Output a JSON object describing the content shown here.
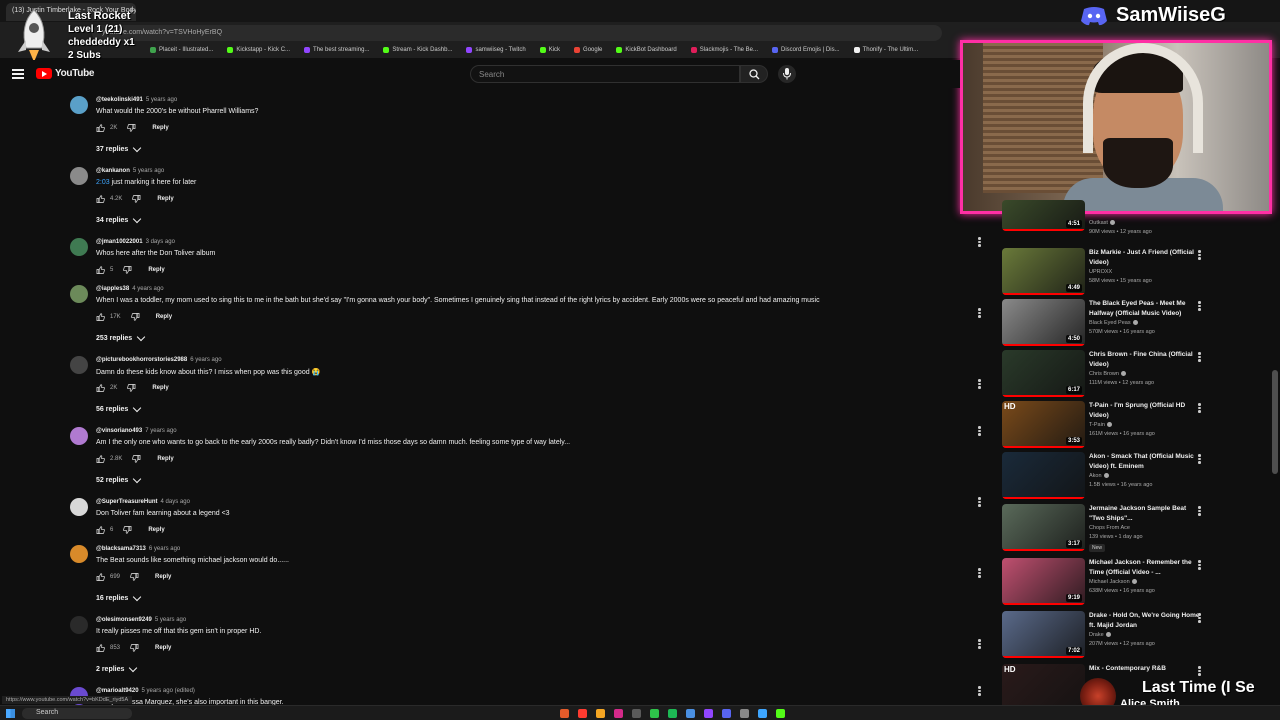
{
  "browser": {
    "tab_title": "(13) Justin Timberlake - Rock Your Body",
    "new_tab_glyph": "+",
    "url": "youtube.com/watch?v=TSVHoHyErBQ",
    "bookmarks": [
      {
        "label": "Placeit - Illustrated...",
        "color": "#3fa34d"
      },
      {
        "label": "Kickstapp - Kick C...",
        "color": "#53fc18"
      },
      {
        "label": "The best streaming...",
        "color": "#9146ff"
      },
      {
        "label": "Stream - Kick Dashb...",
        "color": "#53fc18"
      },
      {
        "label": "samwiiseg - Twitch",
        "color": "#9146ff"
      },
      {
        "label": "Kick",
        "color": "#53fc18"
      },
      {
        "label": "Google",
        "color": "#ea4335"
      },
      {
        "label": "KickBot Dashboard",
        "color": "#53fc18"
      },
      {
        "label": "Slackmojis - The Be...",
        "color": "#e01e5a"
      },
      {
        "label": "Discord Emojis | Dis...",
        "color": "#5865f2"
      },
      {
        "label": "Thonify - The Ultim...",
        "color": "#f1f1f1"
      }
    ]
  },
  "overlay": {
    "line1": "Last Rocket",
    "line2": "Level 1 (21)",
    "line3": "cheddeddy x1",
    "line4": "2 Subs",
    "discord_name": "SamWiiseG"
  },
  "youtube": {
    "logo_text": "YouTube",
    "search_placeholder": "Search"
  },
  "comments": [
    {
      "user": "@teekolinski491",
      "time": "5 years ago",
      "text": "What would the 2000's be without Pharrell Williams?",
      "likes": "2K",
      "reply": "Reply",
      "replies": "37 replies",
      "avatar": "#5aa0c8"
    },
    {
      "user": "@kankanon",
      "time": "5 years ago",
      "timestamp": "2:03",
      "text": " just marking it here for later",
      "likes": "4.2K",
      "reply": "Reply",
      "replies": "34 replies",
      "avatar": "#8a8a8a"
    },
    {
      "user": "@jman10022001",
      "time": "3 days ago",
      "text": "Whos here after the Don Toliver album",
      "likes": "5",
      "reply": "Reply",
      "replies": "",
      "avatar": "#3f7a52"
    },
    {
      "user": "@iapples38",
      "time": "4 years ago",
      "text": "When I was a toddler, my mom used to sing this to me in the bath but she'd say \"I'm gonna wash your body\". Sometimes I genuinely sing that instead of the right lyrics by accident. Early 2000s were so peaceful and had amazing music",
      "likes": "17K",
      "reply": "Reply",
      "replies": "253 replies",
      "avatar": "#6c8a5a"
    },
    {
      "user": "@picturebookhorrorstories2988",
      "time": "6 years ago",
      "text": "Damn do these kids know about this? I miss when pop was this good 😭",
      "likes": "2K",
      "reply": "Reply",
      "replies": "56 replies",
      "avatar": "#444444"
    },
    {
      "user": "@vinsoriano493",
      "time": "7 years ago",
      "text": "Am I the only one who wants to go back to the early 2000s really badly? Didn't know I'd miss those days so damn much. feeling some type of way lately...",
      "likes": "2.8K",
      "reply": "Reply",
      "replies": "52 replies",
      "avatar": "#b07ad0"
    },
    {
      "user": "@SuperTreasureHunt",
      "time": "4 days ago",
      "text": "Don Toliver fam learning about a legend <3",
      "likes": "6",
      "reply": "Reply",
      "replies": "",
      "avatar": "#d8d8d8"
    },
    {
      "user": "@blacksama7313",
      "time": "6 years ago",
      "text": "The Beat sounds like something michael jackson would do......",
      "likes": "699",
      "reply": "Reply",
      "replies": "16 replies",
      "avatar": "#d88a2a"
    },
    {
      "user": "@olesimonsen9249",
      "time": "5 years ago",
      "text": "It really pisses me off that this gem isn't in proper HD.",
      "likes": "853",
      "reply": "Reply",
      "replies": "2 replies",
      "avatar": "#2a2a2a"
    },
    {
      "user": "@marioalt9420",
      "time": "5 years ago (edited)",
      "text": "als by Vanessa Marquez, she's also important in this banger.",
      "likes": "",
      "reply": "",
      "replies": "",
      "avatar": "#6a4ad0"
    }
  ],
  "recommendations": [
    {
      "title": "",
      "channel": "Outkast",
      "meta": "90M views • 12 years ago",
      "duration": "4:51",
      "verified": true,
      "hd": false,
      "new": false,
      "thumb": "#3a4a2a"
    },
    {
      "title": "Biz Markie - Just A Friend (Official Video)",
      "channel": "UPROXX",
      "meta": "58M views • 15 years ago",
      "duration": "4:49",
      "verified": false,
      "hd": false,
      "new": false,
      "thumb": "#6a7a3a"
    },
    {
      "title": "The Black Eyed Peas - Meet Me Halfway (Official Music Video)",
      "channel": "Black Eyed Peas",
      "meta": "570M views • 16 years ago",
      "duration": "4:50",
      "verified": true,
      "hd": false,
      "new": false,
      "thumb": "#8a8a8a"
    },
    {
      "title": "Chris Brown - Fine China (Official Video)",
      "channel": "Chris Brown",
      "meta": "111M views • 12 years ago",
      "duration": "6:17",
      "verified": true,
      "hd": false,
      "new": false,
      "thumb": "#2a3a2a"
    },
    {
      "title": "T-Pain - I'm Sprung (Official HD Video)",
      "channel": "T-Pain",
      "meta": "161M views • 16 years ago",
      "duration": "3:53",
      "verified": true,
      "hd": true,
      "hd_label": "HD",
      "new": false,
      "thumb": "#7a4a1a"
    },
    {
      "title": "Akon - Smack That (Official Music Video) ft. Eminem",
      "channel": "Akon",
      "meta": "1.5B views • 16 years ago",
      "duration": "",
      "verified": true,
      "hd": false,
      "new": false,
      "thumb": "#1a2a3a"
    },
    {
      "title": "Jermaine Jackson Sample Beat \"Two Ships\"...",
      "channel": "Chops From Ace",
      "meta": "139 views • 1 day ago",
      "duration": "3:17",
      "verified": false,
      "hd": false,
      "new": true,
      "new_label": "New",
      "thumb": "#5a6a5a"
    },
    {
      "title": "Michael Jackson - Remember the Time (Official Video - ...",
      "channel": "Michael Jackson",
      "meta": "638M views • 16 years ago",
      "duration": "9:19",
      "verified": true,
      "hd": false,
      "new": false,
      "thumb": "#c05070"
    },
    {
      "title": "Drake - Hold On, We're Going Home ft. Majid Jordan",
      "channel": "Drake",
      "meta": "207M views • 12 years ago",
      "duration": "7:02",
      "verified": true,
      "hd": false,
      "new": false,
      "thumb": "#5a6a8a"
    },
    {
      "title": "Mix - Contemporary R&B",
      "channel": "",
      "meta": "",
      "duration": "",
      "verified": false,
      "hd": true,
      "hd_label": "HD",
      "new": false,
      "thumb": "#2a1a1a"
    }
  ],
  "now_playing": {
    "title": "Last Time (I Se",
    "artist": "Alice Smith"
  },
  "status": {
    "url": "https://www.youtube.com/watch?v=bKDdE_riyd5A"
  },
  "taskbar": {
    "search_label": "Search"
  }
}
